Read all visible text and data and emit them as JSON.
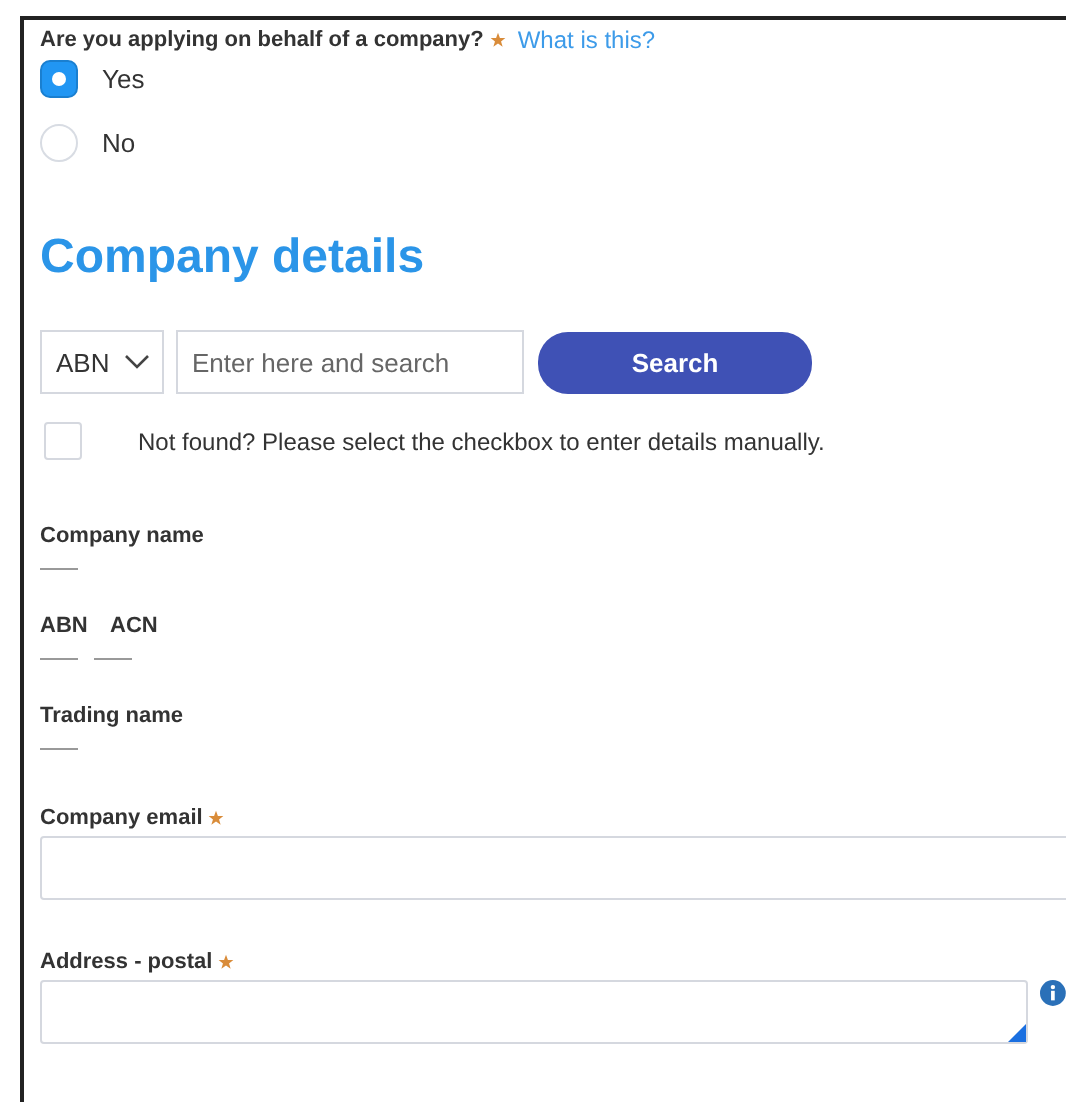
{
  "question": {
    "label": "Are you applying on behalf of a company?",
    "required": true,
    "link": "What is this?"
  },
  "options": [
    {
      "label": "Yes",
      "selected": true
    },
    {
      "label": "No",
      "selected": false
    }
  ],
  "heading": "Company details",
  "search": {
    "id_type": "ABN",
    "placeholder": "Enter here and search",
    "button": "Search"
  },
  "manual": {
    "label": "Not found? Please select the checkbox to enter details manually.",
    "checked": false
  },
  "details": [
    {
      "labels": [
        "Company name"
      ]
    },
    {
      "labels": [
        "ABN",
        "ACN"
      ]
    },
    {
      "labels": [
        "Trading name"
      ]
    }
  ],
  "fields": [
    {
      "label": "Company email",
      "required": true,
      "kind": "input"
    },
    {
      "label": "Address - postal",
      "required": true,
      "kind": "textarea"
    }
  ]
}
